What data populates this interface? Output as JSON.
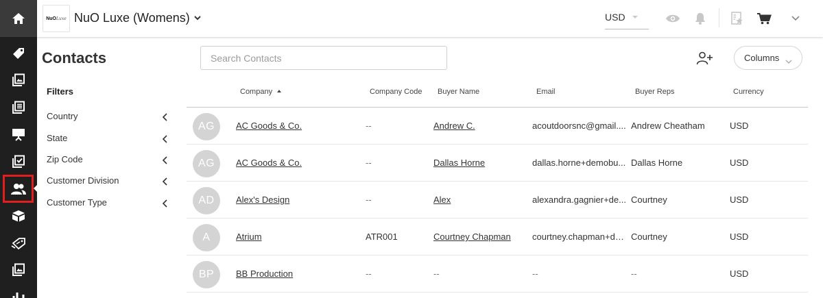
{
  "app": {
    "logo_text": "NuO",
    "logo_script": "Luxe",
    "brand_name": "NuO Luxe (Womens)"
  },
  "topbar": {
    "currency": "USD"
  },
  "page": {
    "title": "Contacts"
  },
  "search": {
    "placeholder": "Search Contacts",
    "value": ""
  },
  "toolbar": {
    "columns_label": "Columns"
  },
  "filters": {
    "title": "Filters",
    "items": [
      "Country",
      "State",
      "Zip Code",
      "Customer Division",
      "Customer Type"
    ]
  },
  "table": {
    "headers": {
      "company": "Company",
      "company_code": "Company Code",
      "buyer_name": "Buyer Name",
      "email": "Email",
      "buyer_reps": "Buyer Reps",
      "currency": "Currency"
    },
    "rows": [
      {
        "initials": "AG",
        "company": "AC Goods & Co.",
        "company_code": "--",
        "buyer_name": "Andrew C.",
        "email": "acoutdoorsnc@gmail....",
        "buyer_reps": "Andrew Cheatham",
        "currency": "USD"
      },
      {
        "initials": "AG",
        "company": "AC Goods & Co.",
        "company_code": "--",
        "buyer_name": "Dallas Horne",
        "email": "dallas.horne+demobu...",
        "buyer_reps": "Dallas Horne",
        "currency": "USD"
      },
      {
        "initials": "AD",
        "company": "Alex's Design",
        "company_code": "--",
        "buyer_name": "Alex",
        "email": "alexandra.gagnier+de...",
        "buyer_reps": "Courtney",
        "currency": "USD"
      },
      {
        "initials": "A",
        "company": "Atrium",
        "company_code": "ATR001",
        "buyer_name": "Courtney Chapman",
        "email": "courtney.chapman+de...",
        "buyer_reps": "Courtney",
        "currency": "USD"
      },
      {
        "initials": "BP",
        "company": "BB Production",
        "company_code": "--",
        "buyer_name": "--",
        "email": "--",
        "buyer_reps": "--",
        "currency": "USD"
      }
    ]
  },
  "colors": {
    "rail_bg": "#1f1f1f",
    "highlight": "#e41d1d",
    "avatar_bg": "#d4d4d4"
  }
}
